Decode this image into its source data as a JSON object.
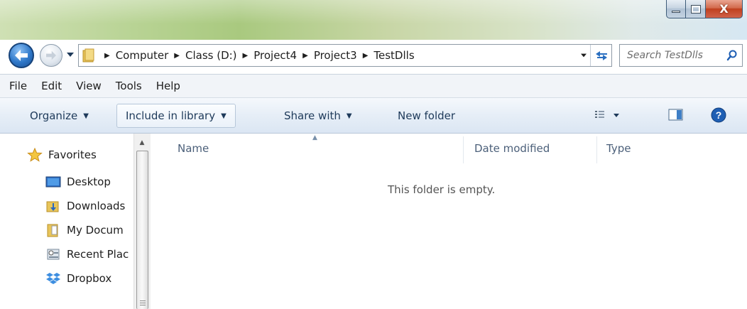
{
  "window": {
    "caption": {
      "minimize_icon": "minimize-icon",
      "maximize_icon": "maximize-icon",
      "close_label": "X"
    }
  },
  "nav": {
    "back_icon": "back-arrow-icon",
    "forward_icon": "forward-arrow-icon",
    "breadcrumbs": [
      {
        "label": "Computer"
      },
      {
        "label": "Class (D:)"
      },
      {
        "label": "Project4"
      },
      {
        "label": "Project3"
      },
      {
        "label": "TestDlls"
      }
    ],
    "search_placeholder": "Search TestDlls"
  },
  "menu": {
    "items": [
      "File",
      "Edit",
      "View",
      "Tools",
      "Help"
    ]
  },
  "commands": {
    "organize": "Organize",
    "include": "Include in library",
    "share": "Share with",
    "new_folder": "New folder"
  },
  "sidebar": {
    "favorites": "Favorites",
    "items": [
      {
        "label": "Desktop",
        "icon": "desktop-icon"
      },
      {
        "label": "Downloads",
        "icon": "downloads-folder-icon"
      },
      {
        "label": "My Docum",
        "icon": "documents-icon"
      },
      {
        "label": "Recent Plac",
        "icon": "recent-places-icon"
      },
      {
        "label": "Dropbox",
        "icon": "dropbox-icon"
      }
    ]
  },
  "filelist": {
    "columns": [
      "Name",
      "Date modified",
      "Type"
    ],
    "empty_message": "This folder is empty."
  },
  "colors": {
    "accent": "#2f78c9",
    "header_text": "#4c607a",
    "command_text": "#1e3a5a"
  }
}
